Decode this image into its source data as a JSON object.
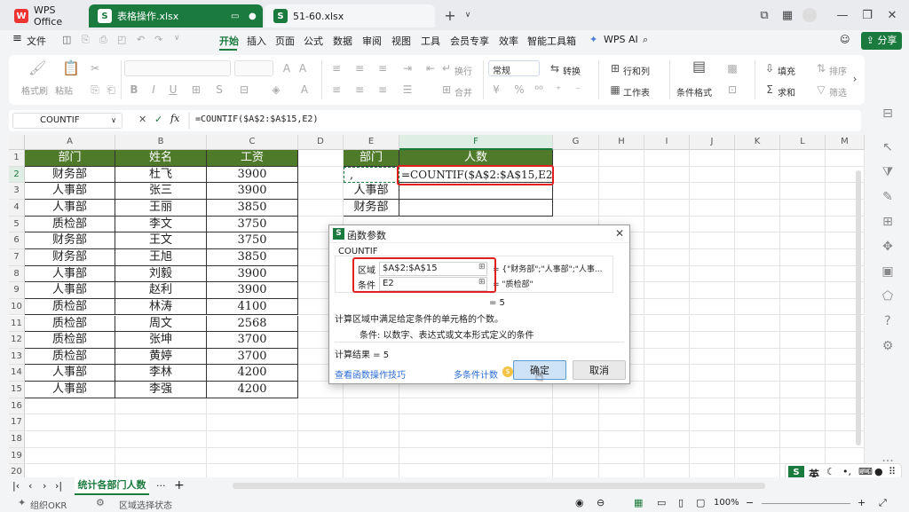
{
  "tabs": [
    {
      "label": "WPS Office"
    },
    {
      "label": "表格操作.xlsx"
    },
    {
      "label": "51-60.xlsx"
    }
  ],
  "menu": {
    "file": "文件",
    "items": [
      "开始",
      "插入",
      "页面",
      "公式",
      "数据",
      "审阅",
      "视图",
      "工具",
      "会员专享",
      "效率",
      "智能工具箱"
    ],
    "wps_ai": "WPS AI",
    "share": "分享"
  },
  "ribbon": {
    "format_painter": "格式刷",
    "paste": "粘贴",
    "wrap": "换行",
    "merge": "合并",
    "number_format": "常规",
    "convert": "转换",
    "rows_cols": "行和列",
    "worksheet": "工作表",
    "cond_format": "条件格式",
    "fill": "填充",
    "sort": "排序",
    "sum": "求和",
    "filter": "筛选"
  },
  "formula_bar": {
    "name_box": "COUNTIF",
    "fx": "fx",
    "formula": "=COUNTIF($A$2:$A$15,E2)"
  },
  "columns": [
    "A",
    "B",
    "C",
    "D",
    "E",
    "F",
    "G",
    "H",
    "I",
    "J",
    "K",
    "L",
    "M"
  ],
  "rows": [
    "1",
    "2",
    "3",
    "4",
    "5",
    "6",
    "7",
    "8",
    "9",
    "10",
    "11",
    "12",
    "13",
    "14",
    "15",
    "16",
    "17",
    "18",
    "19",
    "20"
  ],
  "table": {
    "headers": [
      "部门",
      "姓名",
      "工资"
    ],
    "data": [
      [
        "财务部",
        "杜飞",
        "3900"
      ],
      [
        "人事部",
        "张三",
        "3900"
      ],
      [
        "人事部",
        "王丽",
        "3850"
      ],
      [
        "质检部",
        "李文",
        "3750"
      ],
      [
        "财务部",
        "王文",
        "3750"
      ],
      [
        "财务部",
        "王旭",
        "3850"
      ],
      [
        "人事部",
        "刘毅",
        "3900"
      ],
      [
        "人事部",
        "赵利",
        "3900"
      ],
      [
        "质检部",
        "林涛",
        "4100"
      ],
      [
        "质检部",
        "周文",
        "2568"
      ],
      [
        "质检部",
        "张坤",
        "3700"
      ],
      [
        "质检部",
        "黄婷",
        "3700"
      ],
      [
        "人事部",
        "李林",
        "4200"
      ],
      [
        "人事部",
        "李强",
        "4200"
      ]
    ]
  },
  "summary": {
    "header_dept": "部门",
    "header_count": "人数",
    "e2": ",",
    "f2": "=COUNTIF($A$2:$A$15,E2)",
    "e3": "人事部",
    "e4": "财务部"
  },
  "dialog": {
    "title": "函数参数",
    "func_name": "COUNTIF",
    "range_label": "区域",
    "range_value": "$A$2:$A$15",
    "range_result": "= {\"财务部\";\"人事部\";\"人事...",
    "criteria_label": "条件",
    "criteria_value": "E2",
    "criteria_result": "= \"质检部\"",
    "result_eq": "= 5",
    "description": "计算区域中满足给定条件的单元格的个数。",
    "param_desc": "条件:  以数字、表达式或文本形式定义的条件",
    "calc_result": "计算结果 = 5",
    "tips_link": "查看函数操作技巧",
    "multi_link": "多条件计数",
    "ok": "确定",
    "cancel": "取消"
  },
  "sheet_tabs": {
    "active": "统计各部门人数",
    "more": "···",
    "add": "+"
  },
  "status": {
    "org": "组织OKR",
    "mode": "区域选择状态",
    "zoom": "100%"
  },
  "ime": {
    "lang": "英"
  },
  "colors": {
    "accent": "#1b7a3e",
    "header_green": "#4f7a2a",
    "highlight_red": "#e02020",
    "primary_button": "#cfe3f7"
  }
}
